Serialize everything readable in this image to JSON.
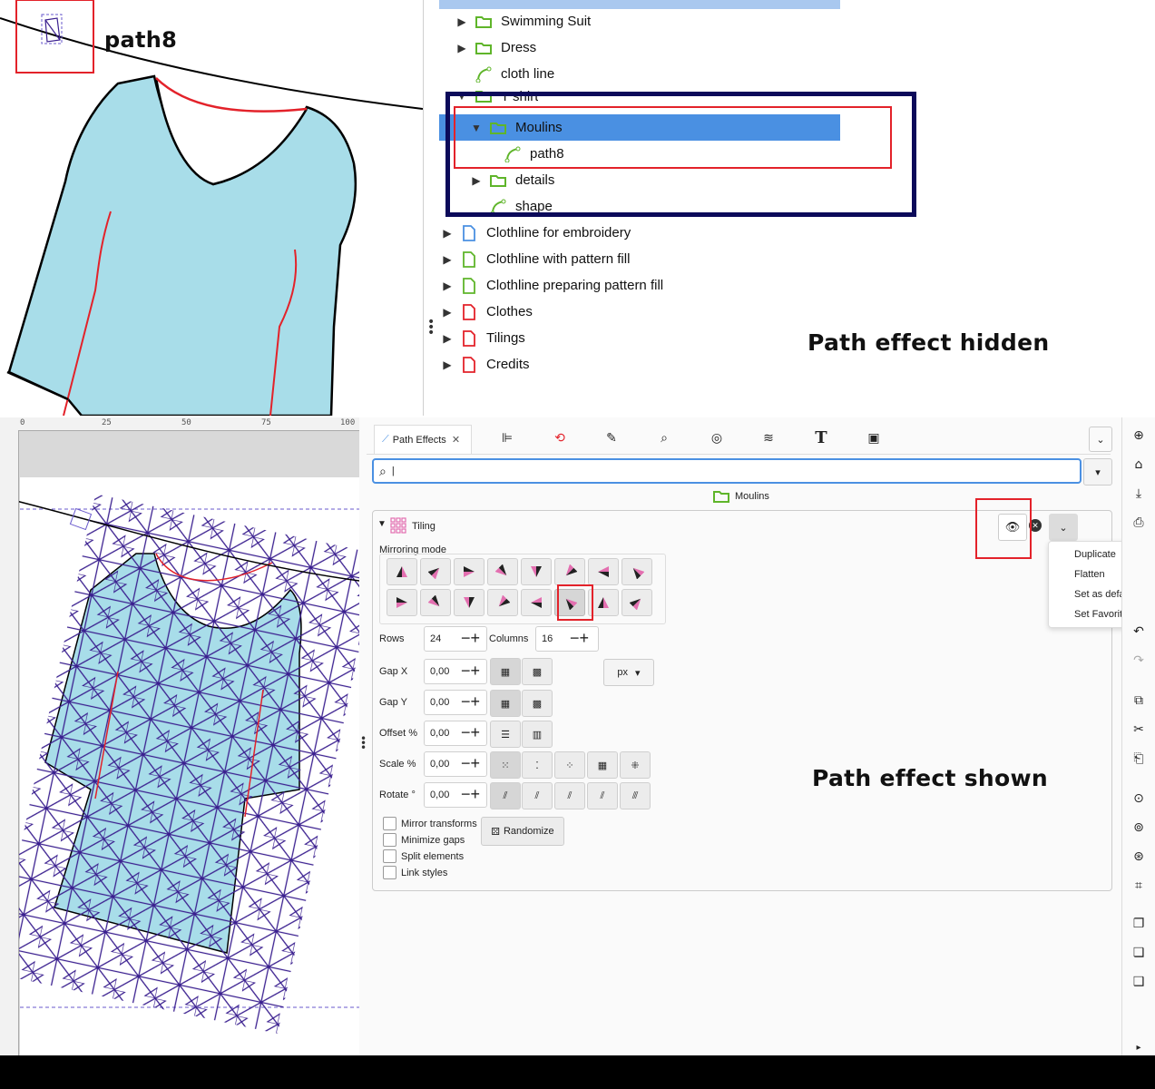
{
  "top": {
    "canvas": {
      "object_label": "path8"
    },
    "layers": {
      "items": [
        {
          "label": "Swimming Suit",
          "type": "folder",
          "expand": "collapsed"
        },
        {
          "label": "Dress",
          "type": "folder",
          "expand": "collapsed"
        },
        {
          "label": "cloth line",
          "type": "path",
          "expand": "none"
        },
        {
          "label": "T shirt",
          "type": "folder",
          "expand": "expanded"
        },
        {
          "label": "Moulins",
          "type": "folder",
          "expand": "expanded",
          "selected": true
        },
        {
          "label": "path8",
          "type": "path",
          "expand": "none"
        },
        {
          "label": "details",
          "type": "folder",
          "expand": "collapsed"
        },
        {
          "label": "shape",
          "type": "path",
          "expand": "none"
        },
        {
          "label": "Clothline for embroidery",
          "type": "page-blue",
          "expand": "collapsed"
        },
        {
          "label": "Clothline  with pattern fill",
          "type": "page-green",
          "expand": "collapsed"
        },
        {
          "label": "Clothline  preparing pattern fill",
          "type": "page-green",
          "expand": "collapsed"
        },
        {
          "label": "Clothes",
          "type": "page-red",
          "expand": "collapsed"
        },
        {
          "label": "Tilings",
          "type": "page-red",
          "expand": "collapsed"
        },
        {
          "label": "Credits",
          "type": "page-red",
          "expand": "collapsed"
        }
      ]
    },
    "caption": "Path effect hidden"
  },
  "bottom": {
    "ruler_ticks": [
      "0",
      "25",
      "50",
      "75",
      "100"
    ],
    "tabs": {
      "active_label": "Path Effects",
      "icons": [
        "align-icon",
        "transform-icon",
        "fill-stroke-icon",
        "find-icon",
        "objects-icon",
        "layers-icon",
        "text-icon",
        "document-icon"
      ]
    },
    "search": {
      "value": "|"
    },
    "breadcrumb": "Moulins",
    "effect": {
      "name": "Tiling",
      "mirroring_label": "Mirroring mode",
      "rows_label": "Rows",
      "rows_value": "24",
      "columns_label": "Columns",
      "columns_value": "16",
      "gap_x_label": "Gap X",
      "gap_x_value": "0,00",
      "gap_y_label": "Gap Y",
      "gap_y_value": "0,00",
      "offset_label": "Offset %",
      "offset_value": "0,00",
      "scale_label": "Scale %",
      "scale_value": "0,00",
      "rotate_label": "Rotate °",
      "rotate_value": "0,00",
      "unit": "px",
      "checkboxes": [
        "Mirror transforms",
        "Minimize gaps",
        "Split elements",
        "Link styles"
      ],
      "randomize_label": "Randomize"
    },
    "dropdown_menu": [
      "Duplicate",
      "Flatten",
      "Set as default",
      "Set Favorite"
    ],
    "caption": "Path effect shown",
    "colors": {
      "accent": "#4a90e2",
      "highlight_red": "#e3222a",
      "navy": "#0c0a5a",
      "tshirt": "#a8dde9",
      "pattern": "#3a1f8f"
    }
  }
}
